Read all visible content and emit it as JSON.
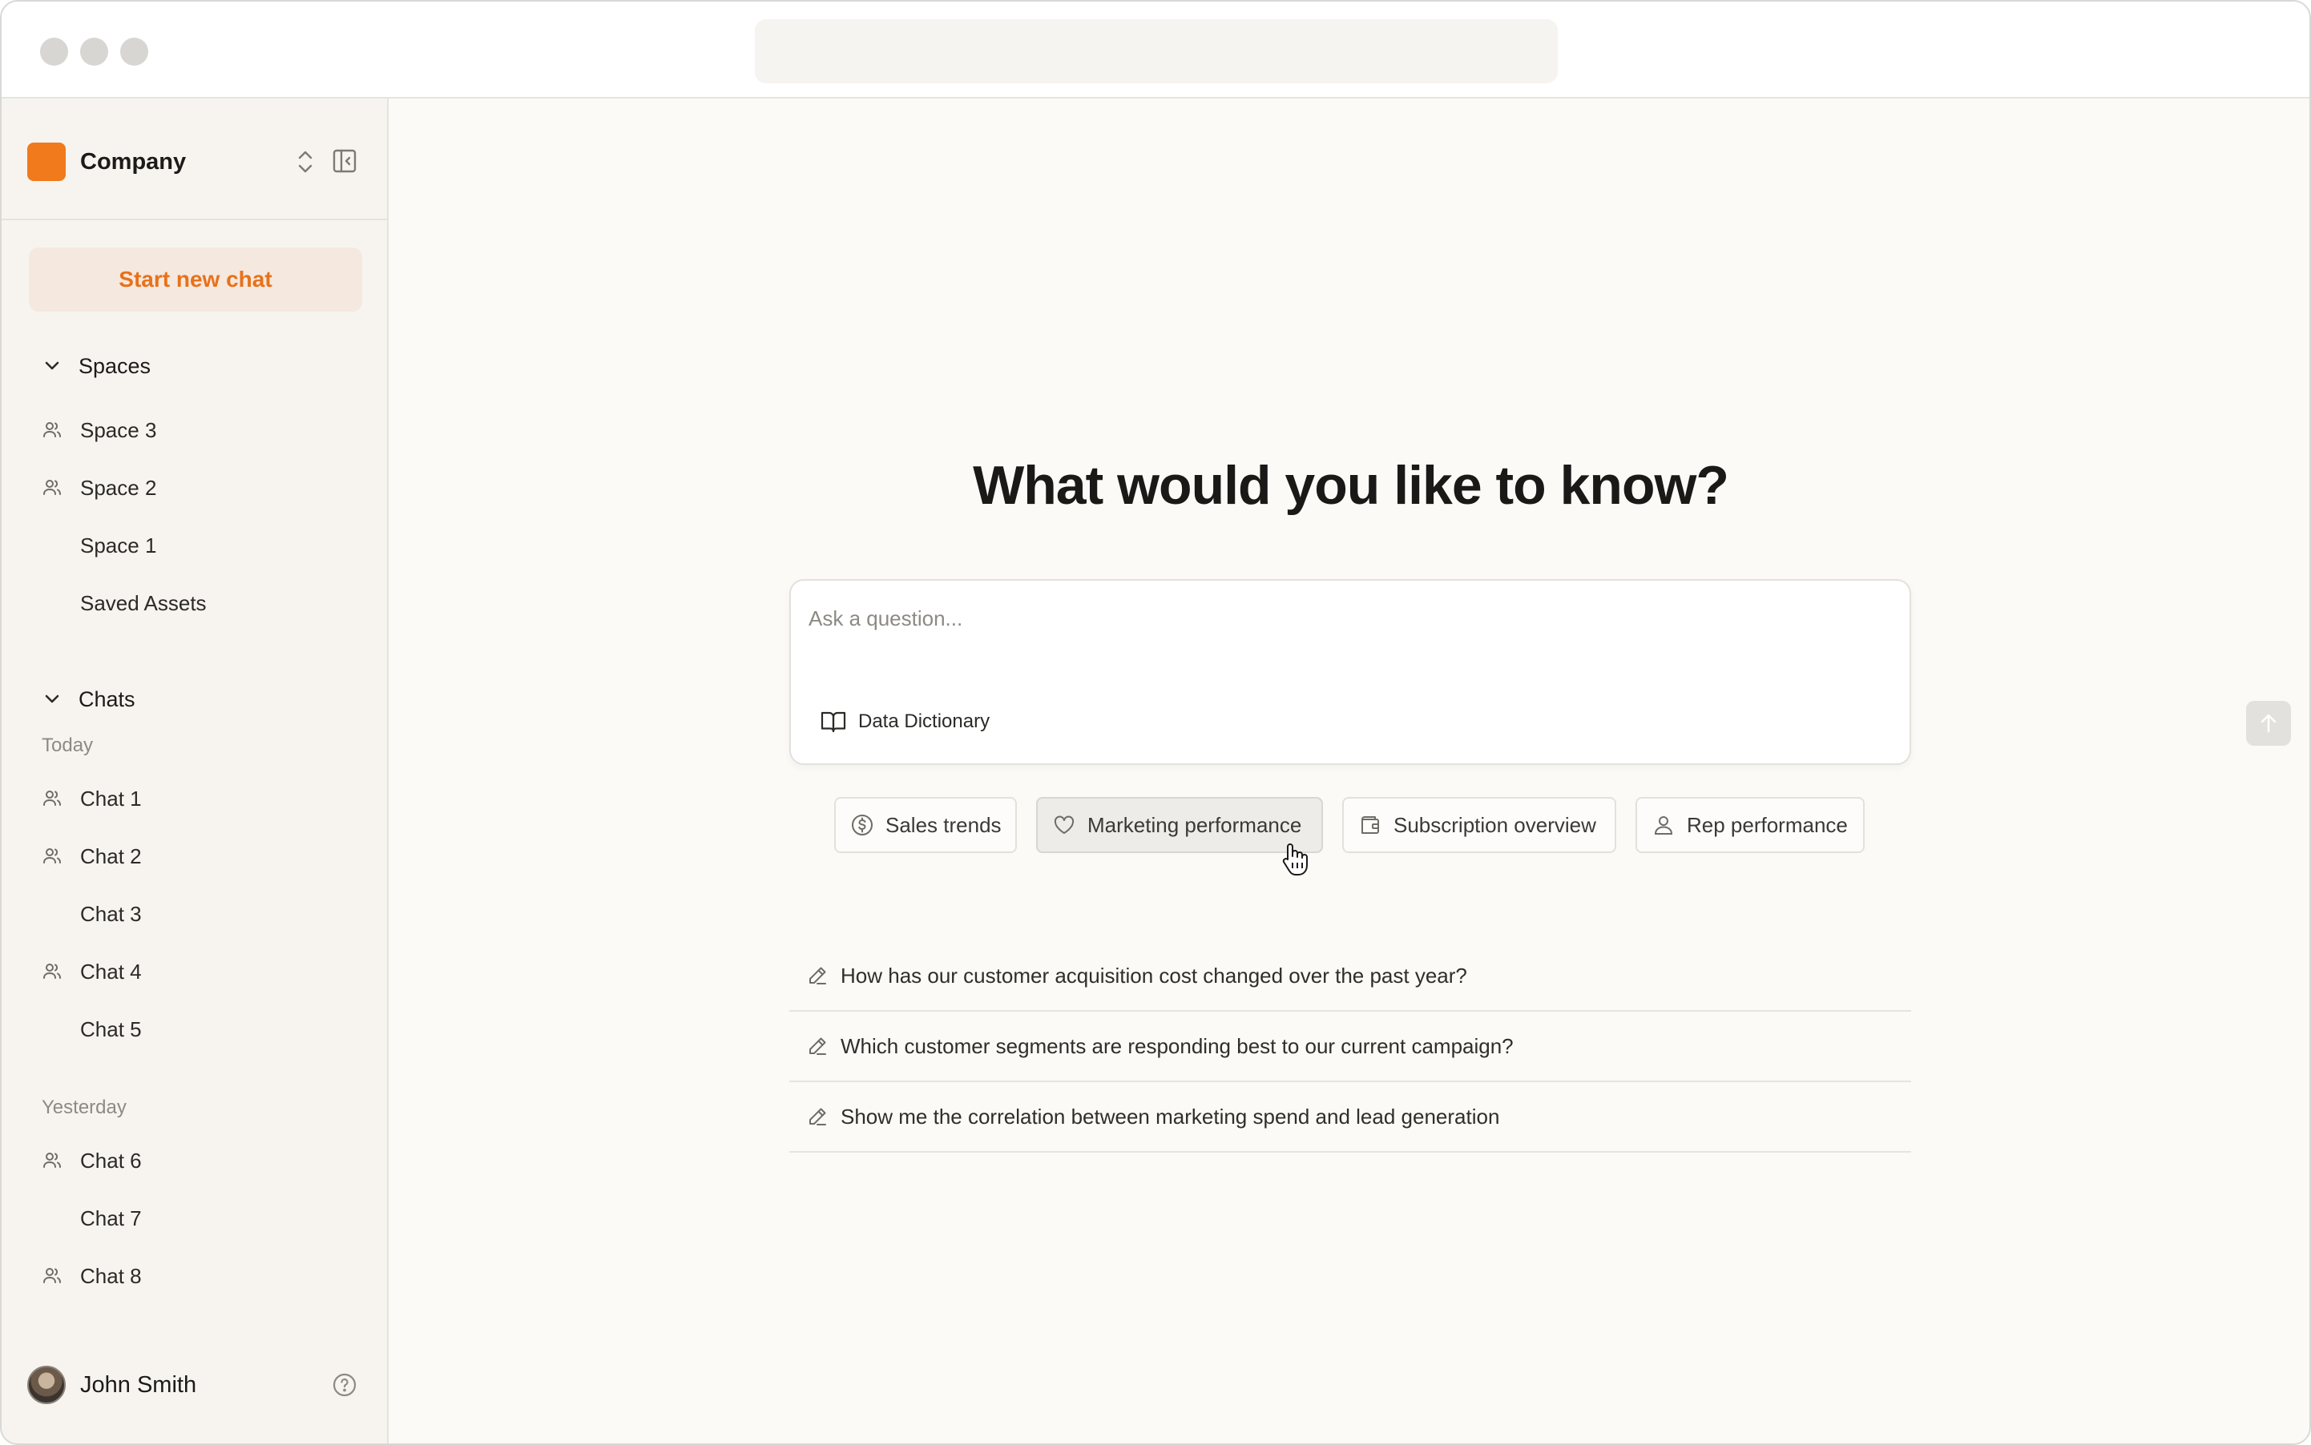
{
  "sidebar": {
    "company": {
      "name": "Company",
      "logo_color": "#f07a1c"
    },
    "new_chat_label": "Start new chat",
    "spaces_header": "Spaces",
    "spaces": [
      {
        "label": "Space 3",
        "icon": "people-icon"
      },
      {
        "label": "Space 2",
        "icon": "people-icon"
      },
      {
        "label": "Space 1",
        "icon": ""
      },
      {
        "label": "Saved Assets",
        "icon": ""
      }
    ],
    "chats_header": "Chats",
    "groups": [
      {
        "label": "Today",
        "chats": [
          {
            "label": "Chat 1",
            "icon": "people-icon"
          },
          {
            "label": "Chat 2",
            "icon": "people-icon"
          },
          {
            "label": "Chat 3",
            "icon": ""
          },
          {
            "label": "Chat 4",
            "icon": "people-icon"
          },
          {
            "label": "Chat 5",
            "icon": ""
          }
        ]
      },
      {
        "label": "Yesterday",
        "chats": [
          {
            "label": "Chat 6",
            "icon": "people-icon"
          },
          {
            "label": "Chat 7",
            "icon": ""
          },
          {
            "label": "Chat 8",
            "icon": "people-icon"
          }
        ]
      }
    ],
    "user": {
      "name": "John Smith"
    }
  },
  "main": {
    "headline": "What would you like to know?",
    "composer": {
      "placeholder": "Ask a question...",
      "dictionary_label": "Data Dictionary"
    },
    "chips": [
      {
        "label": "Sales trends",
        "icon": "dollar-circle-icon"
      },
      {
        "label": "Marketing performance",
        "icon": "heart-icon",
        "hovered": true
      },
      {
        "label": "Subscription overview",
        "icon": "wallet-icon"
      },
      {
        "label": "Rep performance",
        "icon": "user-icon"
      }
    ],
    "suggestions": [
      "How has our customer acquisition cost changed over the past year?",
      "Which customer segments are responding best to our current campaign?",
      "Show me the correlation between marketing spend and lead generation"
    ]
  },
  "colors": {
    "accent": "#e8711a",
    "sidebar_bg": "#f7f4ef",
    "main_bg": "#fbfaf7"
  }
}
